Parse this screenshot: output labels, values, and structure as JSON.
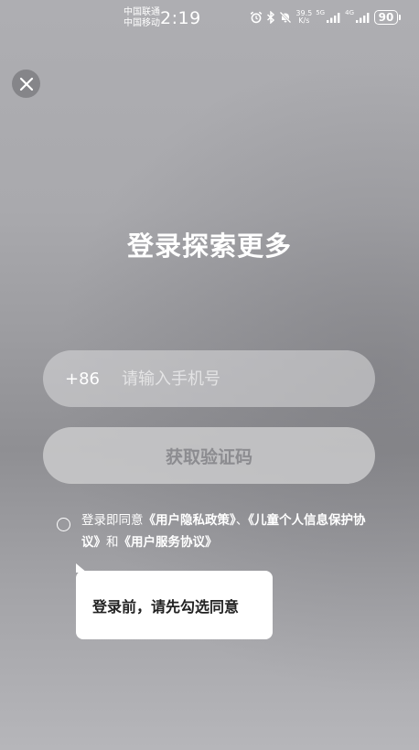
{
  "status_bar": {
    "carrier_1": "中国联通",
    "carrier_2": "中国移动",
    "time": "2:19",
    "speed_value": "39.5",
    "speed_unit": "K/s",
    "net_1": "5G",
    "net_2": "4G",
    "battery": "90"
  },
  "title": "登录探索更多",
  "phone": {
    "country_code": "+86",
    "placeholder": "请输入手机号",
    "value": ""
  },
  "code_button_label": "获取验证码",
  "agreement": {
    "prefix": "登录即同意",
    "privacy_link": "《用户隐私政策》",
    "separator": "、",
    "child_link": "《儿童个人信息保护协议》",
    "conjunction": "和",
    "service_link": "《用户服务协议》",
    "checked": false
  },
  "tooltip": "登录前，请先勾选同意",
  "colors": {
    "background": "#a7a7ab",
    "text": "#ffffff",
    "button_text": "#8c8c90",
    "tooltip_bg": "#ffffff"
  }
}
